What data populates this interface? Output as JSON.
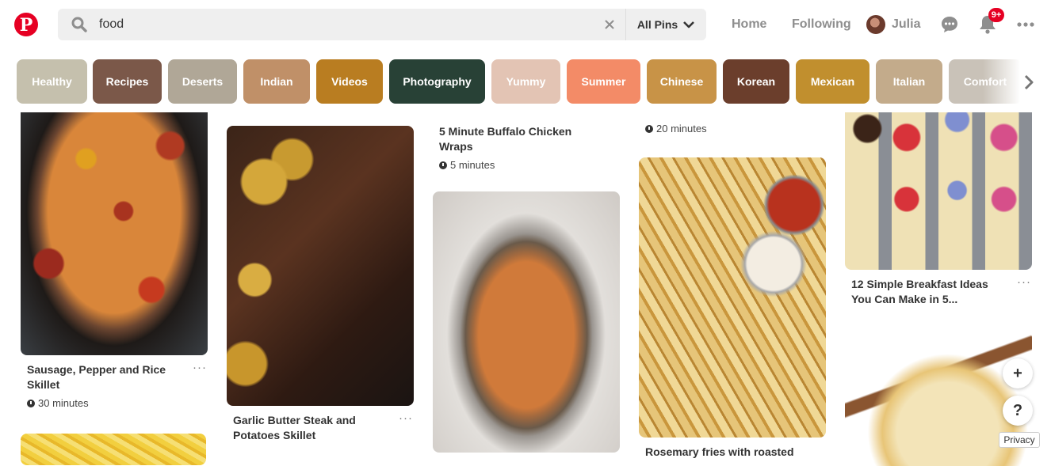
{
  "header": {
    "logo_icon": "pinterest-logo",
    "search": {
      "value": "food",
      "placeholder": "Search"
    },
    "scope_label": "All Pins",
    "nav": {
      "home": "Home",
      "following": "Following"
    },
    "user_name": "Julia",
    "notification_badge": "9+",
    "icons": [
      "search-icon",
      "clear-icon",
      "chevron-down-icon",
      "messages-icon",
      "bell-icon",
      "more-icon"
    ],
    "accent_color": "#e60023"
  },
  "categories": [
    {
      "label": "Healthy",
      "color": "#c5c0ad"
    },
    {
      "label": "Recipes",
      "color": "#7b5849"
    },
    {
      "label": "Deserts",
      "color": "#b0a797"
    },
    {
      "label": "Indian",
      "color": "#c09068"
    },
    {
      "label": "Videos",
      "color": "#b97d21"
    },
    {
      "label": "Photography",
      "color": "#284136"
    },
    {
      "label": "Yummy",
      "color": "#e3c4b4"
    },
    {
      "label": "Summer",
      "color": "#f38b67"
    },
    {
      "label": "Chinese",
      "color": "#c89347"
    },
    {
      "label": "Korean",
      "color": "#6b3e2c"
    },
    {
      "label": "Mexican",
      "color": "#c18f2e"
    },
    {
      "label": "Italian",
      "color": "#c3ab8b"
    },
    {
      "label": "Comfort",
      "color": "#c9c2b8"
    }
  ],
  "pins": [
    {
      "title": "Sausage, Pepper and Rice Skillet",
      "time": "30 minutes"
    },
    {
      "title": "Garlic Butter Steak and Potatoes Skillet",
      "time": ""
    },
    {
      "title": "5 Minute Buffalo Chicken Wraps",
      "time": "5 minutes"
    },
    {
      "title": "",
      "time": ""
    },
    {
      "title": "",
      "time": "20 minutes"
    },
    {
      "title": "Rosemary fries with roasted",
      "time": ""
    },
    {
      "title": "12 Simple Breakfast Ideas You Can Make in 5...",
      "time": ""
    },
    {
      "title": "",
      "time": ""
    }
  ],
  "floating": {
    "add": "+",
    "help": "?",
    "privacy": "Privacy"
  }
}
